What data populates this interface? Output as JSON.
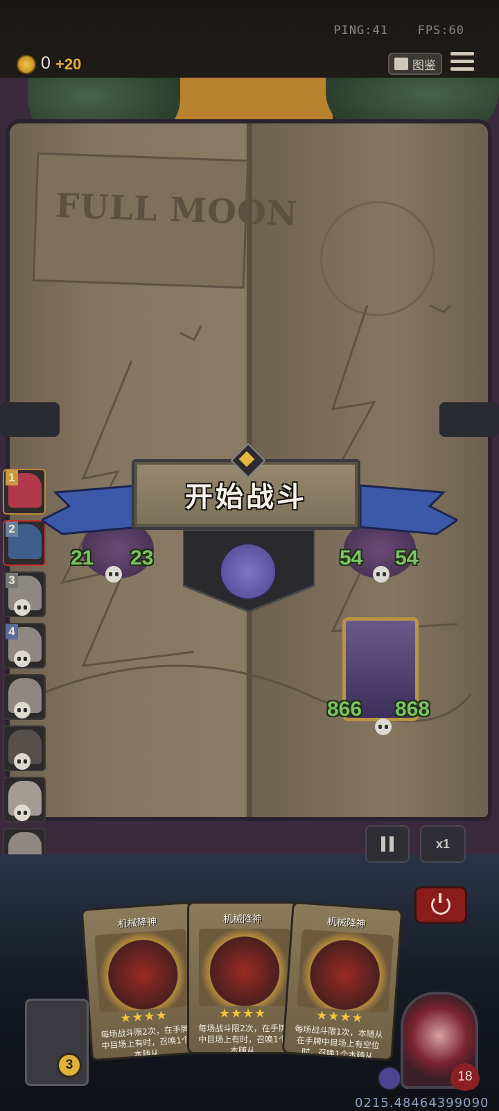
{
  "hud": {
    "ping": "PING:41",
    "fps": "FPS:60",
    "coins": "0",
    "coin_bonus": "+20",
    "codex_label": "图鉴"
  },
  "book": {
    "sign_text": "FULL MOON"
  },
  "banner": {
    "title": "开始战斗"
  },
  "sidebar": {
    "slots": [
      {
        "number": "1",
        "state": "active"
      },
      {
        "number": "2",
        "state": "selected"
      },
      {
        "number": "3",
        "state": "defeated"
      },
      {
        "number": "4",
        "state": "defeated"
      },
      {
        "number": "",
        "state": "defeated"
      },
      {
        "number": "",
        "state": "defeated"
      },
      {
        "number": "",
        "state": "defeated"
      },
      {
        "number": "",
        "state": "defeated"
      }
    ]
  },
  "units": {
    "left": {
      "attack": "21",
      "health": "23"
    },
    "right": {
      "attack": "54",
      "health": "54"
    },
    "robot": {
      "attack": "866",
      "health": "868"
    }
  },
  "controls": {
    "speed_label": "x1"
  },
  "hand": {
    "cards": [
      {
        "name": "机械降神",
        "stars": "★★★★",
        "desc": "每场战斗限2次，在手牌中目场上有时，召唤1个本随从"
      },
      {
        "name": "机械降神",
        "stars": "★★★★",
        "desc": "每场战斗限2次，在手牌中目场上有时，召唤1个本随从"
      },
      {
        "name": "机械降神",
        "stars": "★★★★",
        "desc": "每场战斗限1次，本随从在手牌中目场上有空位时，召唤1个本随从"
      }
    ],
    "deck_count": "3"
  },
  "hero": {
    "health": "18"
  },
  "footer": {
    "id": "0215.48464399090"
  }
}
